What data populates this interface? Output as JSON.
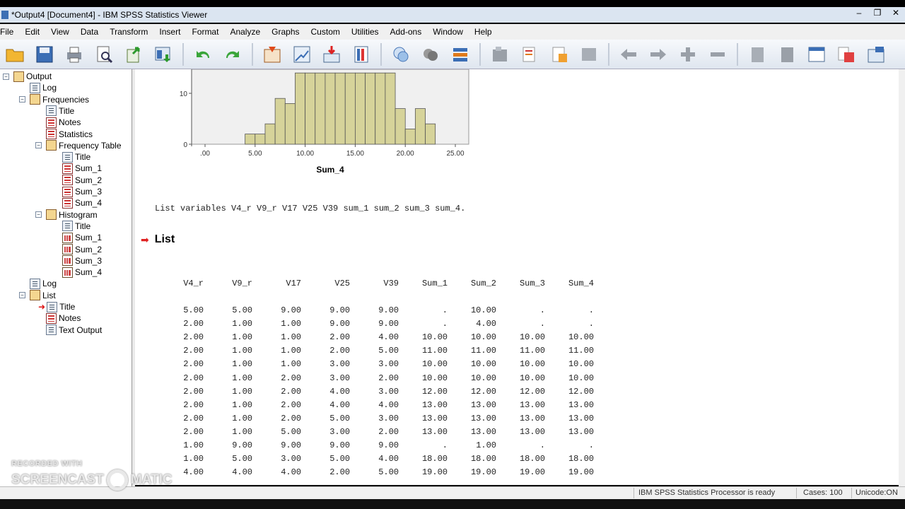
{
  "window": {
    "title": "*Output4 [Document4] - IBM SPSS Statistics Viewer",
    "controls": [
      "–",
      "❐",
      "✕"
    ]
  },
  "menu": [
    "File",
    "Edit",
    "View",
    "Data",
    "Transform",
    "Insert",
    "Format",
    "Analyze",
    "Graphs",
    "Custom",
    "Utilities",
    "Add-ons",
    "Window",
    "Help"
  ],
  "toolbar_icons": [
    "open-icon",
    "save-icon",
    "print-icon",
    "print-preview-icon",
    "export-icon",
    "recall-dialog-icon",
    "undo-icon",
    "redo-icon",
    "goto-data-icon",
    "goto-case-icon",
    "insert-variable-icon",
    "variables-icon",
    "designate-window-icon",
    "select-cases-icon",
    "value-labels-icon",
    "use-sets-icon",
    "show-all-icon",
    "hide-icon",
    "back-icon",
    "forward-icon",
    "expand-icon",
    "collapse-icon",
    "show-icon",
    "hide-output-icon",
    "insert-heading-icon",
    "insert-title-icon",
    "insert-text-icon"
  ],
  "tree": [
    {
      "label": "Output",
      "level": 0,
      "icon": "book",
      "toggle": "−"
    },
    {
      "label": "Log",
      "level": 1,
      "icon": "doc"
    },
    {
      "label": "Frequencies",
      "level": 1,
      "icon": "book",
      "toggle": "−"
    },
    {
      "label": "Title",
      "level": 2,
      "icon": "doc"
    },
    {
      "label": "Notes",
      "level": 2,
      "icon": "tab"
    },
    {
      "label": "Statistics",
      "level": 2,
      "icon": "tab"
    },
    {
      "label": "Frequency Table",
      "level": 2,
      "icon": "book",
      "toggle": "−"
    },
    {
      "label": "Title",
      "level": 3,
      "icon": "doc"
    },
    {
      "label": "Sum_1",
      "level": 3,
      "icon": "tab"
    },
    {
      "label": "Sum_2",
      "level": 3,
      "icon": "tab"
    },
    {
      "label": "Sum_3",
      "level": 3,
      "icon": "tab"
    },
    {
      "label": "Sum_4",
      "level": 3,
      "icon": "tab"
    },
    {
      "label": "Histogram",
      "level": 2,
      "icon": "book",
      "toggle": "−"
    },
    {
      "label": "Title",
      "level": 3,
      "icon": "doc"
    },
    {
      "label": "Sum_1",
      "level": 3,
      "icon": "chart"
    },
    {
      "label": "Sum_2",
      "level": 3,
      "icon": "chart"
    },
    {
      "label": "Sum_3",
      "level": 3,
      "icon": "chart"
    },
    {
      "label": "Sum_4",
      "level": 3,
      "icon": "chart"
    },
    {
      "label": "Log",
      "level": 1,
      "icon": "doc"
    },
    {
      "label": "List",
      "level": 1,
      "icon": "book",
      "toggle": "−"
    },
    {
      "label": "Title",
      "level": 2,
      "icon": "doc",
      "active": true
    },
    {
      "label": "Notes",
      "level": 2,
      "icon": "tab"
    },
    {
      "label": "Text Output",
      "level": 2,
      "icon": "doc"
    }
  ],
  "histogram": {
    "xlabel": "Sum_4",
    "y_ticks": [
      "10",
      "0"
    ],
    "x_ticks": [
      ".00",
      "5.00",
      "10.00",
      "15.00",
      "20.00",
      "25.00"
    ],
    "xlim": [
      0,
      25
    ],
    "bar_width": 1,
    "bars": [
      {
        "x": 4.5,
        "h": 2
      },
      {
        "x": 5.5,
        "h": 2
      },
      {
        "x": 6.5,
        "h": 4
      },
      {
        "x": 7.5,
        "h": 9
      },
      {
        "x": 8.5,
        "h": 8
      },
      {
        "x": 9.5,
        "h": 14
      },
      {
        "x": 10.5,
        "h": 14
      },
      {
        "x": 11.5,
        "h": 14
      },
      {
        "x": 12.5,
        "h": 14
      },
      {
        "x": 13.5,
        "h": 14
      },
      {
        "x": 14.5,
        "h": 14
      },
      {
        "x": 15.5,
        "h": 14
      },
      {
        "x": 16.5,
        "h": 14
      },
      {
        "x": 17.5,
        "h": 14
      },
      {
        "x": 18.5,
        "h": 14
      },
      {
        "x": 19.5,
        "h": 7
      },
      {
        "x": 20.5,
        "h": 3
      },
      {
        "x": 21.5,
        "h": 7
      },
      {
        "x": 22.5,
        "h": 4
      }
    ],
    "ymax_visible": 14
  },
  "syntax": "List variables V4_r V9_r V17 V25 V39 sum_1 sum_2 sum_3 sum_4.",
  "list_title": "List",
  "listing": {
    "columns": [
      "V4_r",
      "V9_r",
      "V17",
      "V25",
      "V39",
      "Sum_1",
      "Sum_2",
      "Sum_3",
      "Sum_4"
    ],
    "rows": [
      [
        "5.00",
        "5.00",
        "9.00",
        "9.00",
        "9.00",
        ".",
        "10.00",
        ".",
        "."
      ],
      [
        "2.00",
        "1.00",
        "1.00",
        "9.00",
        "9.00",
        ".",
        "4.00",
        ".",
        "."
      ],
      [
        "2.00",
        "1.00",
        "1.00",
        "2.00",
        "4.00",
        "10.00",
        "10.00",
        "10.00",
        "10.00"
      ],
      [
        "2.00",
        "1.00",
        "1.00",
        "2.00",
        "5.00",
        "11.00",
        "11.00",
        "11.00",
        "11.00"
      ],
      [
        "2.00",
        "1.00",
        "1.00",
        "3.00",
        "3.00",
        "10.00",
        "10.00",
        "10.00",
        "10.00"
      ],
      [
        "2.00",
        "1.00",
        "2.00",
        "3.00",
        "2.00",
        "10.00",
        "10.00",
        "10.00",
        "10.00"
      ],
      [
        "2.00",
        "1.00",
        "2.00",
        "4.00",
        "3.00",
        "12.00",
        "12.00",
        "12.00",
        "12.00"
      ],
      [
        "2.00",
        "1.00",
        "2.00",
        "4.00",
        "4.00",
        "13.00",
        "13.00",
        "13.00",
        "13.00"
      ],
      [
        "2.00",
        "1.00",
        "2.00",
        "5.00",
        "3.00",
        "13.00",
        "13.00",
        "13.00",
        "13.00"
      ],
      [
        "2.00",
        "1.00",
        "5.00",
        "3.00",
        "2.00",
        "13.00",
        "13.00",
        "13.00",
        "13.00"
      ],
      [
        "1.00",
        "9.00",
        "9.00",
        "9.00",
        "9.00",
        ".",
        "1.00",
        ".",
        "."
      ],
      [
        "1.00",
        "5.00",
        "3.00",
        "5.00",
        "4.00",
        "18.00",
        "18.00",
        "18.00",
        "18.00"
      ],
      [
        "4.00",
        "4.00",
        "4.00",
        "2.00",
        "5.00",
        "19.00",
        "19.00",
        "19.00",
        "19.00"
      ]
    ]
  },
  "status": {
    "processor": "IBM SPSS Statistics Processor is ready",
    "cases": "Cases: 100",
    "unicode": "Unicode:ON"
  },
  "watermark": {
    "line1": "RECORDED WITH",
    "left": "SCREENCAST",
    "right": "MATIC"
  }
}
